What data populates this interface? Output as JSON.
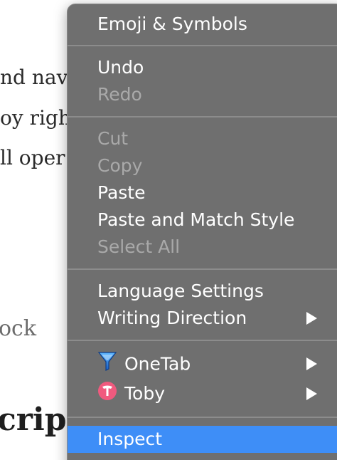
{
  "background": {
    "line1": "nd nav",
    "line2": "oy righ",
    "line3": "ll oper",
    "line4": "ock",
    "heading": "crip"
  },
  "menu": {
    "items": [
      {
        "label": "Emoji & Symbols",
        "enabled": true
      },
      {
        "label": "Undo",
        "enabled": true
      },
      {
        "label": "Redo",
        "enabled": false
      },
      {
        "label": "Cut",
        "enabled": false
      },
      {
        "label": "Copy",
        "enabled": false
      },
      {
        "label": "Paste",
        "enabled": true
      },
      {
        "label": "Paste and Match Style",
        "enabled": true
      },
      {
        "label": "Select All",
        "enabled": false
      },
      {
        "label": "Language Settings",
        "enabled": true
      },
      {
        "label": "Writing Direction",
        "enabled": true,
        "submenu": true
      },
      {
        "label": "OneTab",
        "enabled": true,
        "submenu": true,
        "icon": "onetab-funnel-icon"
      },
      {
        "label": "Toby",
        "enabled": true,
        "submenu": true,
        "icon": "toby-t-icon"
      },
      {
        "label": "Inspect",
        "enabled": true,
        "highlighted": true
      }
    ]
  },
  "colors": {
    "menu_bg": "#6f6f6f",
    "highlight": "#3e8ef7",
    "disabled_text": "#a9a9a9",
    "enabled_text": "#ffffff",
    "onetab_blue": "#2a74d6",
    "toby_pink": "#f05a7e"
  }
}
